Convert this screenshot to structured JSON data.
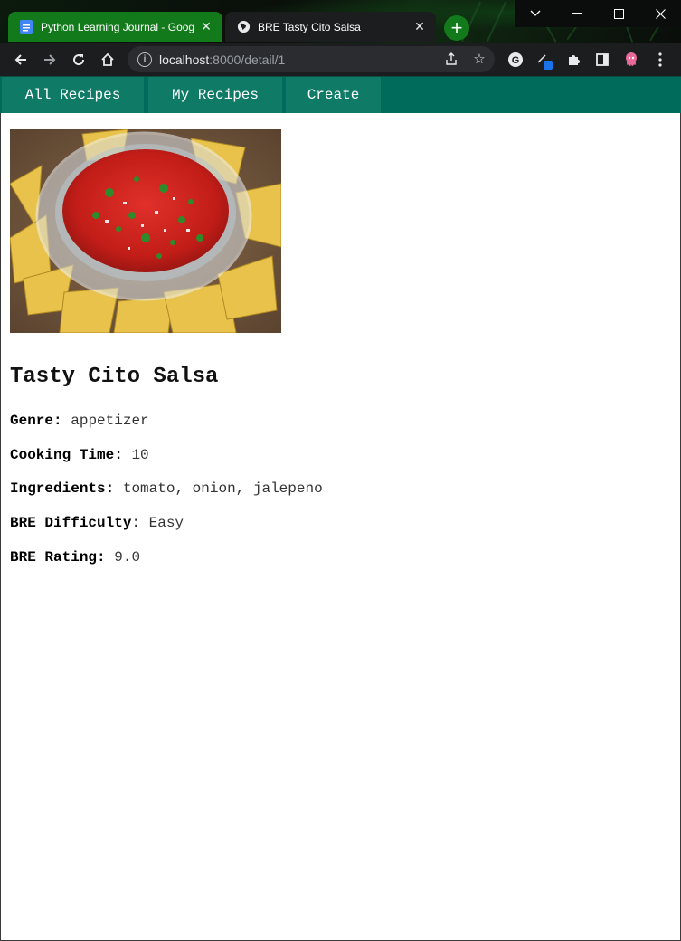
{
  "browser": {
    "tabs": [
      {
        "title": "Python Learning Journal - Googl",
        "icon": "google-docs-icon",
        "active": false
      },
      {
        "title": "BRE Tasty Cito Salsa",
        "icon": "globe-icon",
        "active": true
      }
    ],
    "url_host": "localhost",
    "url_rest": ":8000/detail/1",
    "accent_color": "#137a1b"
  },
  "nav": {
    "all_recipes": "All Recipes",
    "my_recipes": "My Recipes",
    "create": "Create",
    "bar_color": "#006b5a"
  },
  "recipe": {
    "image_alt": "salsa-photo",
    "name": "Tasty Cito Salsa",
    "fields": [
      {
        "label": "Genre",
        "value": "appetizer"
      },
      {
        "label": "Cooking Time",
        "value": "10"
      },
      {
        "label": "Ingredients",
        "value": "tomato, onion, jalepeno"
      },
      {
        "label": "BRE Difficulty",
        "value": "Easy"
      },
      {
        "label": "BRE Rating",
        "value": "9.0"
      }
    ]
  }
}
